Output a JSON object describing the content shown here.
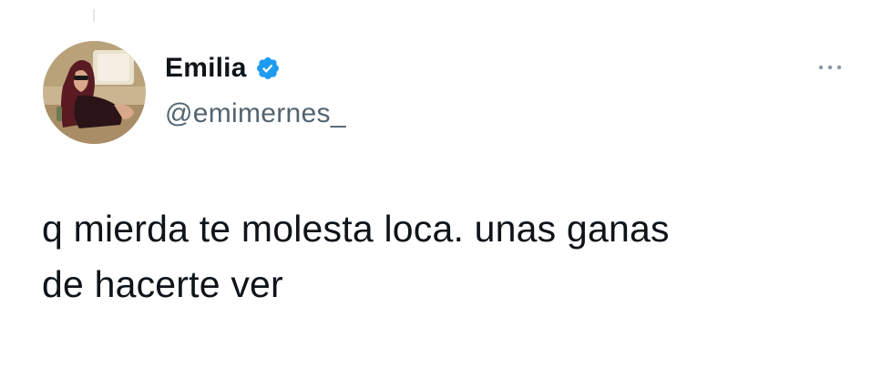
{
  "tweet": {
    "author": {
      "display_name": "Emilia",
      "handle": "@emimernes_",
      "verified": true,
      "avatar_icon": "profile-photo"
    },
    "text": "q mierda te molesta loca. unas ganas\nde hacerte ver",
    "more_icon": "ellipsis-icon"
  },
  "colors": {
    "text_primary": "#0f1419",
    "text_secondary": "#536471",
    "verified_blue": "#1d9bf0",
    "background": "#ffffff"
  }
}
